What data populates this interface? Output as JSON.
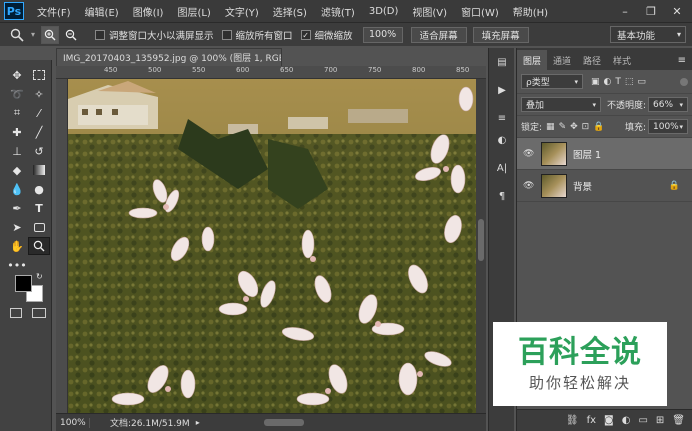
{
  "menubar": {
    "app_icon": "Ps",
    "items": [
      "文件(F)",
      "编辑(E)",
      "图像(I)",
      "图层(L)",
      "文字(Y)",
      "选择(S)",
      "滤镜(T)",
      "3D(D)",
      "视图(V)",
      "窗口(W)",
      "帮助(H)"
    ],
    "minimize": "–",
    "maximize": "❐",
    "close": "✕"
  },
  "options": {
    "resize_label": "调整窗口大小以满屏显示",
    "zoom_all_label": "缩放所有窗口",
    "scrubby_label": "细微缩放",
    "zoom_value": "100%",
    "fit_screen": "适合屏幕",
    "fill_screen": "填充屏幕",
    "workspace": "基本功能"
  },
  "document": {
    "tab_title": "IMG_20170403_135952.jpg @ 100% (图层 1, RGB/8) *",
    "close": "×",
    "ruler_marks": [
      "450",
      "500",
      "550",
      "600",
      "650",
      "700",
      "750",
      "800",
      "850"
    ],
    "zoom_status": "100%",
    "doc_info": "文档:26.1M/51.9M"
  },
  "layers_panel": {
    "tabs": [
      "图层",
      "通道",
      "路径",
      "样式"
    ],
    "kind_filter": "ρ类型",
    "blend_mode": "叠加",
    "opacity_label": "不透明度:",
    "opacity_value": "66%",
    "lock_label": "锁定:",
    "fill_label": "填充:",
    "fill_value": "100%",
    "layers": [
      {
        "name": "图层 1",
        "selected": true,
        "locked": false
      },
      {
        "name": "背景",
        "selected": false,
        "locked": true
      }
    ]
  },
  "watermark": {
    "title": "百科全说",
    "subtitle": "助你轻松解决"
  }
}
